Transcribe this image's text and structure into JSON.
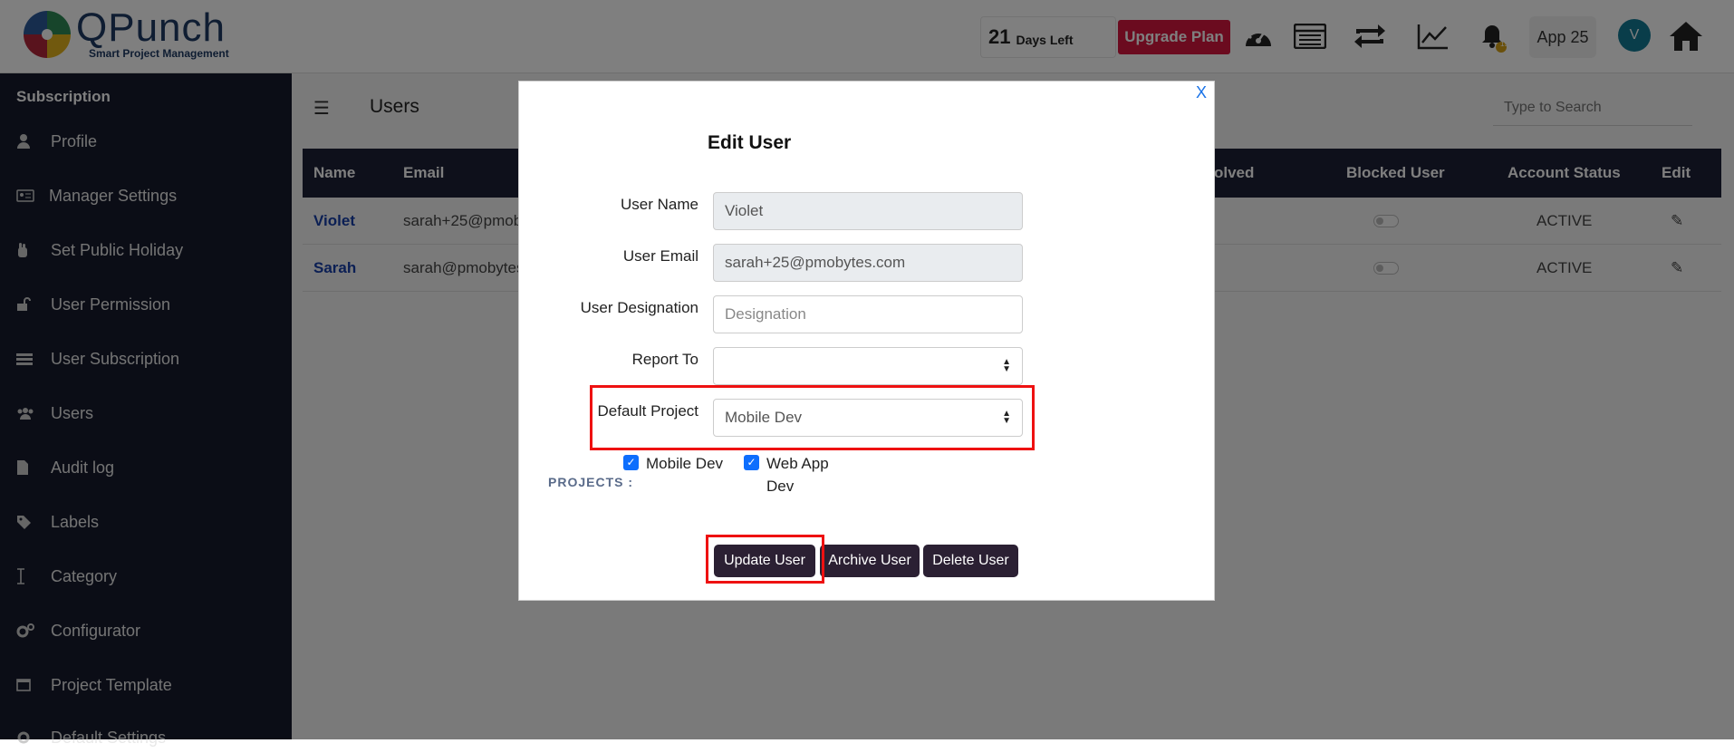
{
  "app": {
    "name": "QPunch",
    "tagline": "Smart Project Management"
  },
  "header": {
    "days_left_number": "21",
    "days_left_label": "Days Left",
    "upgrade_label": "Upgrade Plan",
    "notification_count": "15",
    "app_name": "App 25",
    "avatar_initial": "V"
  },
  "sidebar": {
    "heading": "Subscription",
    "items": [
      {
        "label": "Profile",
        "icon": "user-icon"
      },
      {
        "label": "Manager Settings",
        "icon": "id-card-icon"
      },
      {
        "label": "Set Public Holiday",
        "icon": "hand-icon"
      },
      {
        "label": "User Permission",
        "icon": "unlock-icon"
      },
      {
        "label": "User Subscription",
        "icon": "list-icon"
      },
      {
        "label": "Users",
        "icon": "users-icon"
      },
      {
        "label": "Audit log",
        "icon": "file-icon"
      },
      {
        "label": "Labels",
        "icon": "tags-icon"
      },
      {
        "label": "Category",
        "icon": "text-cursor-icon"
      },
      {
        "label": "Configurator",
        "icon": "gears-icon"
      },
      {
        "label": "Project Template",
        "icon": "window-icon"
      },
      {
        "label": "Default Settings",
        "icon": "gear-icon"
      }
    ]
  },
  "main": {
    "title": "Users",
    "search_placeholder": "Type to Search",
    "columns": [
      "Name",
      "Email",
      "olved",
      "Blocked User",
      "Account Status",
      "Edit"
    ],
    "rows": [
      {
        "name": "Violet",
        "email": "sarah+25@pmob",
        "status": "ACTIVE"
      },
      {
        "name": "Sarah",
        "email": "sarah@pmobytes",
        "status": "ACTIVE"
      }
    ]
  },
  "modal": {
    "close": "X",
    "title": "Edit User",
    "fields": {
      "user_name_label": "User Name",
      "user_name_value": "Violet",
      "user_email_label": "User Email",
      "user_email_value": "sarah+25@pmobytes.com",
      "designation_label": "User Designation",
      "designation_placeholder": "Designation",
      "report_to_label": "Report To",
      "report_to_value": "",
      "default_project_label": "Default Project",
      "default_project_value": "Mobile Dev"
    },
    "projects_label": "PROJECTS :",
    "projects": [
      {
        "label": "Mobile Dev",
        "checked": true
      },
      {
        "label_line1": "Web App",
        "label_line2": "Dev",
        "checked": true
      }
    ],
    "buttons": {
      "update": "Update User",
      "archive": "Archive User",
      "delete": "Delete User"
    }
  },
  "colors": {
    "accent_red": "#d6163e",
    "sidebar_bg": "#161a2d",
    "button_dark": "#2b2033",
    "highlight": "#ee1111"
  }
}
